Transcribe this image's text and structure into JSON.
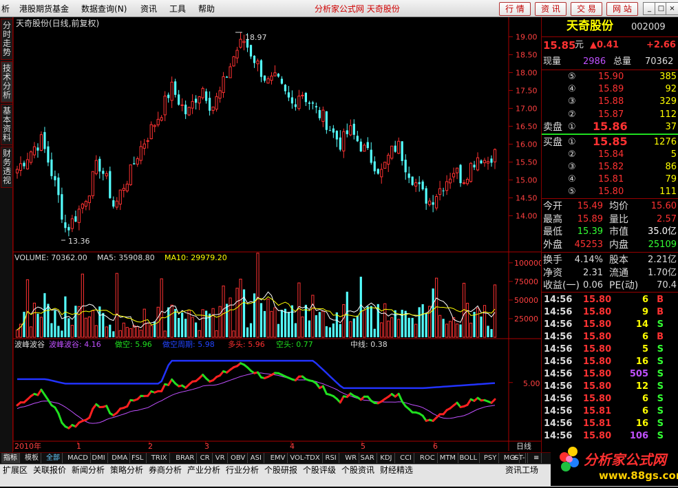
{
  "menu": {
    "items": [
      "析",
      "港股期货基金",
      "数据查询",
      "资讯",
      "工具",
      "帮助"
    ],
    "badge": "N",
    "center_title": "分析家公式网  天奇股份"
  },
  "toolbar": {
    "buttons": [
      "行 情",
      "资 讯",
      "交 易",
      "网 站"
    ]
  },
  "window": {
    "controls": [
      "_",
      "□",
      "×"
    ]
  },
  "left_tabs": [
    "分时走势",
    "技术分析",
    "基本资料",
    "财务透视"
  ],
  "price_chart": {
    "title": "天奇股份(日线,前复权)",
    "high_label": "18.97",
    "low_label": "13.36",
    "y_ticks": [
      "19.00",
      "18.50",
      "18.00",
      "17.50",
      "17.00",
      "16.50",
      "16.00",
      "15.50",
      "15.00",
      "14.50",
      "14.00"
    ]
  },
  "volume_chart": {
    "label_volume": "VOLUME: 70362.00",
    "label_ma5": "MA5: 35908.80",
    "label_ma10": "MA10: 29979.20",
    "y_ticks": [
      "100000",
      "75000",
      "50000",
      "25000"
    ]
  },
  "indicator": {
    "name": "波峰波谷",
    "labels": [
      "波峰波谷: 4.16",
      "做空: 5.96",
      "做空周期: 5.98",
      "多头: 5.96",
      "空头: 0.77",
      "中线: 0.38"
    ],
    "y_tick": "5.00"
  },
  "date_axis": {
    "year": "2010年",
    "months": [
      "1",
      "2",
      "3",
      "4",
      "5",
      "6"
    ],
    "period": "日线"
  },
  "colors": {
    "up": "#ff3232",
    "down": "#54ffff",
    "ma5": "#ffffff",
    "ma10": "#ffff00",
    "line_blue": "#2233ff",
    "line_magenta": "#c050ff",
    "line_red": "#ff2020",
    "line_green": "#20e020"
  },
  "chart_data": {
    "type": "candlestick",
    "title": "天奇股份(日线,前复权)",
    "ylim": [
      13.2,
      19.2
    ],
    "period": "2009-12 to 2010-06",
    "marked_high": 18.97,
    "marked_low": 13.36,
    "close_path": [
      15.3,
      15.6,
      15.9,
      16.1,
      15.4,
      14.6,
      13.6,
      13.9,
      14.3,
      14.8,
      15.5,
      15.0,
      14.2,
      14.8,
      15.2,
      15.8,
      16.2,
      16.6,
      17.0,
      17.6,
      17.2,
      16.8,
      17.3,
      17.6,
      17.0,
      17.4,
      18.0,
      18.6,
      18.9,
      18.5,
      18.1,
      17.7,
      17.8,
      17.4,
      17.1,
      17.5,
      17.2,
      16.9,
      16.7,
      16.3,
      16.0,
      16.4,
      16.1,
      15.8,
      15.5,
      15.2,
      15.7,
      16.0,
      15.4,
      15.0,
      14.6,
      14.4,
      14.7,
      15.0,
      15.3,
      15.0,
      15.4,
      15.7,
      15.5,
      15.85
    ],
    "volume_ylim": [
      0,
      110000
    ],
    "volume_labels": {
      "VOLUME": 70362.0,
      "MA5": 35908.8,
      "MA10": 29979.2
    },
    "indicator_labels": {
      "波峰波谷": 4.16,
      "做空": 5.96,
      "做空周期": 5.98,
      "多头": 5.96,
      "空头": 0.77,
      "中线": 0.38
    }
  },
  "quote": {
    "name": "天奇股份",
    "code": "002009",
    "price": "15.85",
    "unit": "元",
    "change": "▲0.41",
    "change2": "+2.66",
    "current_vol_label": "现量",
    "current_vol": "2986",
    "total_vol_label": "总量",
    "total_vol": "70362",
    "sell": [
      {
        "idx": "⑤",
        "price": "15.90",
        "vol": "385"
      },
      {
        "idx": "④",
        "price": "15.89",
        "vol": "92"
      },
      {
        "idx": "③",
        "price": "15.88",
        "vol": "329"
      },
      {
        "idx": "②",
        "price": "15.87",
        "vol": "112"
      },
      {
        "label": "卖盘",
        "idx": "①",
        "price": "15.86",
        "vol": "37"
      }
    ],
    "buy": [
      {
        "label": "买盘",
        "idx": "①",
        "price": "15.85",
        "vol": "1276"
      },
      {
        "idx": "②",
        "price": "15.84",
        "vol": "5"
      },
      {
        "idx": "③",
        "price": "15.82",
        "vol": "86"
      },
      {
        "idx": "④",
        "price": "15.81",
        "vol": "79"
      },
      {
        "idx": "⑤",
        "price": "15.80",
        "vol": "111"
      }
    ],
    "stats": [
      {
        "l1": "今开",
        "v1": "15.49",
        "c1": "#ff3232",
        "l2": "均价",
        "v2": "15.60",
        "c2": "#ff3232"
      },
      {
        "l1": "最高",
        "v1": "15.89",
        "c1": "#ff3232",
        "l2": "量比",
        "v2": "2.57",
        "c2": "#ff3232"
      },
      {
        "l1": "最低",
        "v1": "15.39",
        "c1": "#33ff33",
        "l2": "市值",
        "v2": "35.0亿",
        "c2": "#ffffff"
      },
      {
        "l1": "外盘",
        "v1": "45253",
        "c1": "#ff3232",
        "l2": "内盘",
        "v2": "25109",
        "c2": "#33ff33"
      }
    ],
    "stats2": [
      {
        "l1": "换手",
        "v1": "4.14%",
        "l2": "股本",
        "v2": "2.21亿"
      },
      {
        "l1": "净资",
        "v1": "2.31",
        "l2": "流通",
        "v2": "1.70亿"
      },
      {
        "l1": "收益(一)",
        "v1": "0.06",
        "l2": "PE(动)",
        "v2": "70.4"
      }
    ],
    "ticks": [
      {
        "t": "14:56",
        "p": "15.80",
        "v": "6",
        "s": "B"
      },
      {
        "t": "14:56",
        "p": "15.80",
        "v": "9",
        "s": "B"
      },
      {
        "t": "14:56",
        "p": "15.80",
        "v": "14",
        "s": "S"
      },
      {
        "t": "14:56",
        "p": "15.80",
        "v": "6",
        "s": "B"
      },
      {
        "t": "14:56",
        "p": "15.80",
        "v": "5",
        "s": "S"
      },
      {
        "t": "14:56",
        "p": "15.80",
        "v": "16",
        "s": "S"
      },
      {
        "t": "14:56",
        "p": "15.80",
        "v": "505",
        "s": "S"
      },
      {
        "t": "14:56",
        "p": "15.80",
        "v": "12",
        "s": "S"
      },
      {
        "t": "14:56",
        "p": "15.80",
        "v": "6",
        "s": "S"
      },
      {
        "t": "14:56",
        "p": "15.81",
        "v": "6",
        "s": "S"
      },
      {
        "t": "14:56",
        "p": "15.81",
        "v": "16",
        "s": "S"
      },
      {
        "t": "14:56",
        "p": "15.80",
        "v": "106",
        "s": "S"
      }
    ]
  },
  "indicator_tabs": [
    "指标",
    "模板",
    "全部",
    "MACD",
    "DMI",
    "DMA",
    "FSL",
    "TRIX",
    "BRAR",
    "CR",
    "VR",
    "OBV",
    "ASI",
    "EMV",
    "VOL-TDX",
    "RSI",
    "WR",
    "SAR",
    "KDJ",
    "CCI",
    "ROC",
    "MTM",
    "BOLL",
    "PSY",
    "MCST"
  ],
  "nav_ctrl": [
    "+",
    "-",
    "≡"
  ],
  "bottom_tabs": [
    "扩展区",
    "关联报价",
    "新闻分析",
    "策略分析",
    "券商分析",
    "产业分析",
    "行业分析",
    "个股研报",
    "个股评级",
    "个股资讯",
    "财经精选"
  ],
  "bottom_right": "资讯工场",
  "logo": {
    "text": "分析家公式网",
    "url": "www.88gs.com"
  }
}
